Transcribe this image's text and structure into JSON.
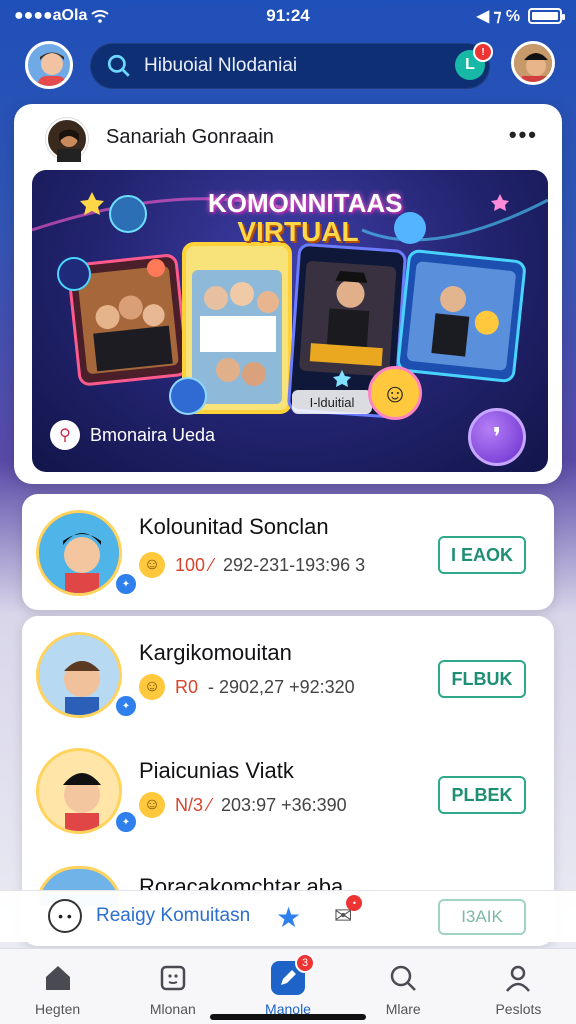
{
  "status_bar": {
    "left": "●●●●aOla ",
    "time": "91:24",
    "right": "◀ ⁊ ℅"
  },
  "header": {
    "search_text": "Hibuoial Nlodaniai"
  },
  "feature": {
    "author_name": "Sanariah Gonraain",
    "more": "•••",
    "banner_title_1": "KOMONNITAAS",
    "banner_title_2": "VIRTUAL",
    "banner_label": "I-lduitial",
    "banner_footer": "Bmonaira Ueda"
  },
  "communities": [
    {
      "title": "Kolounitad Sonclan",
      "meta_red": "100 ⁄",
      "meta": "292-231-193:96 3",
      "button": "I EAOK"
    },
    {
      "title": "Kargikomouitan",
      "meta_red": "R0",
      "meta": "- 2902,27 +92:320",
      "button": "FLBUK"
    },
    {
      "title": "Piaicunias Viatk",
      "meta_red": "N/3 ⁄",
      "meta": "203:97 +36:390",
      "button": "PLBEK"
    },
    {
      "title": "Roracakomchtar aba"
    }
  ],
  "strip": {
    "text": "Reaigy Komuitasn",
    "button": "I3AIK"
  },
  "tabs": [
    {
      "label": "Hegten",
      "icon": "home-icon"
    },
    {
      "label": "Mlonan",
      "icon": "chat-icon"
    },
    {
      "label": "Manole",
      "icon": "create-icon",
      "badge": "3"
    },
    {
      "label": "Mlare",
      "icon": "search-icon"
    },
    {
      "label": "Peslots",
      "icon": "profile-icon"
    }
  ],
  "colors": {
    "brand_blue": "#1e64c8",
    "join_green": "#2fa88a",
    "badge_red": "#e33333"
  }
}
